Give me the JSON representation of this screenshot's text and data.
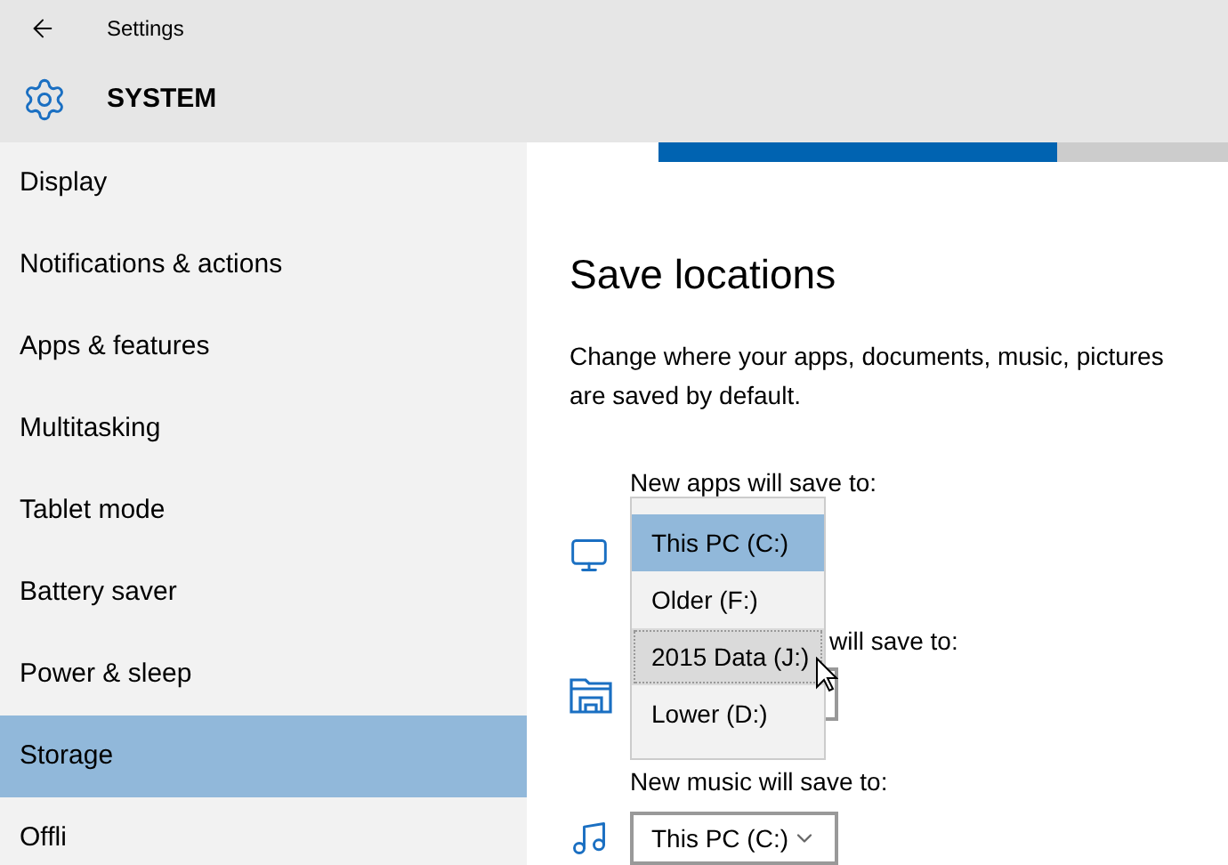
{
  "window": {
    "title": "Settings"
  },
  "header": {
    "title": "SYSTEM"
  },
  "sidebar": {
    "items": [
      {
        "label": "Display",
        "selected": false
      },
      {
        "label": "Notifications & actions",
        "selected": false
      },
      {
        "label": "Apps & features",
        "selected": false
      },
      {
        "label": "Multitasking",
        "selected": false
      },
      {
        "label": "Tablet mode",
        "selected": false
      },
      {
        "label": "Battery saver",
        "selected": false
      },
      {
        "label": "Power & sleep",
        "selected": false
      },
      {
        "label": "Storage",
        "selected": true
      },
      {
        "label": "Offli",
        "selected": false
      }
    ]
  },
  "storage_bar": {
    "level": 0.7
  },
  "section": {
    "title": "Save locations",
    "description": "Change where your apps, documents, music, pictures\nare saved by default."
  },
  "apps": {
    "label": "New apps will save to:",
    "options": [
      {
        "label": "This PC (C:)",
        "selected": true,
        "hovered": false
      },
      {
        "label": "Older (F:)",
        "selected": false,
        "hovered": false
      },
      {
        "label": "2015 Data (J:)",
        "selected": false,
        "hovered": true
      },
      {
        "label": "Lower (D:)",
        "selected": false,
        "hovered": false
      }
    ]
  },
  "documents": {
    "label": "will save to:"
  },
  "music": {
    "label": "New music will save to:",
    "value": "This PC (C:)"
  }
}
